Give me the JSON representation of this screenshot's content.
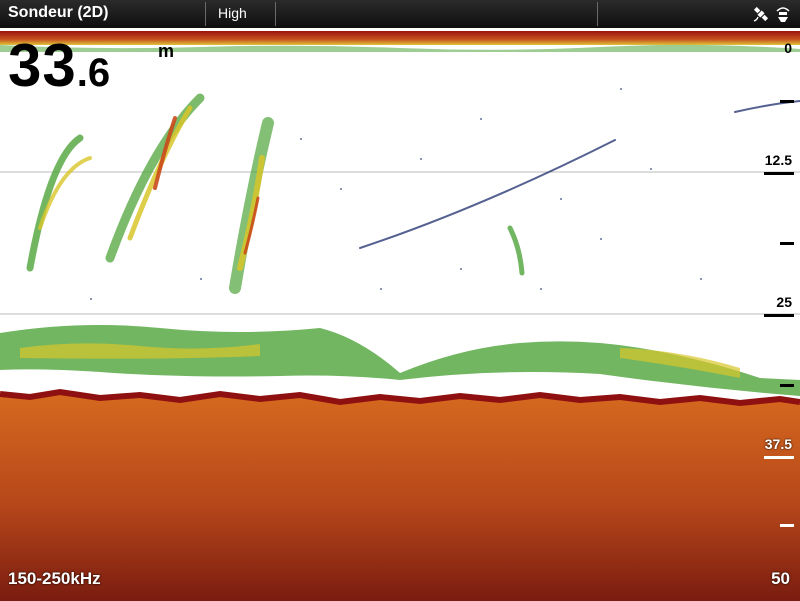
{
  "header": {
    "title": "Sondeur (2D)",
    "mode": "High",
    "icons": [
      "satellite-icon",
      "sonar-transducer-icon"
    ]
  },
  "readout": {
    "depth_int": "33",
    "depth_dec": ".6",
    "unit": "m"
  },
  "sonar": {
    "frequency": "150-250kHz",
    "scale_labels": [
      "0",
      "12.5",
      "25",
      "37.5"
    ],
    "scale_max": "50"
  },
  "colors": {
    "background": "#ffffff",
    "bottom": "#d9691e",
    "bottom_edge": "#8f1010",
    "surface": "#a11a10",
    "fish_green": "#59b83a",
    "fish_yellow": "#d8c62a",
    "noise": "#2b3a75"
  }
}
